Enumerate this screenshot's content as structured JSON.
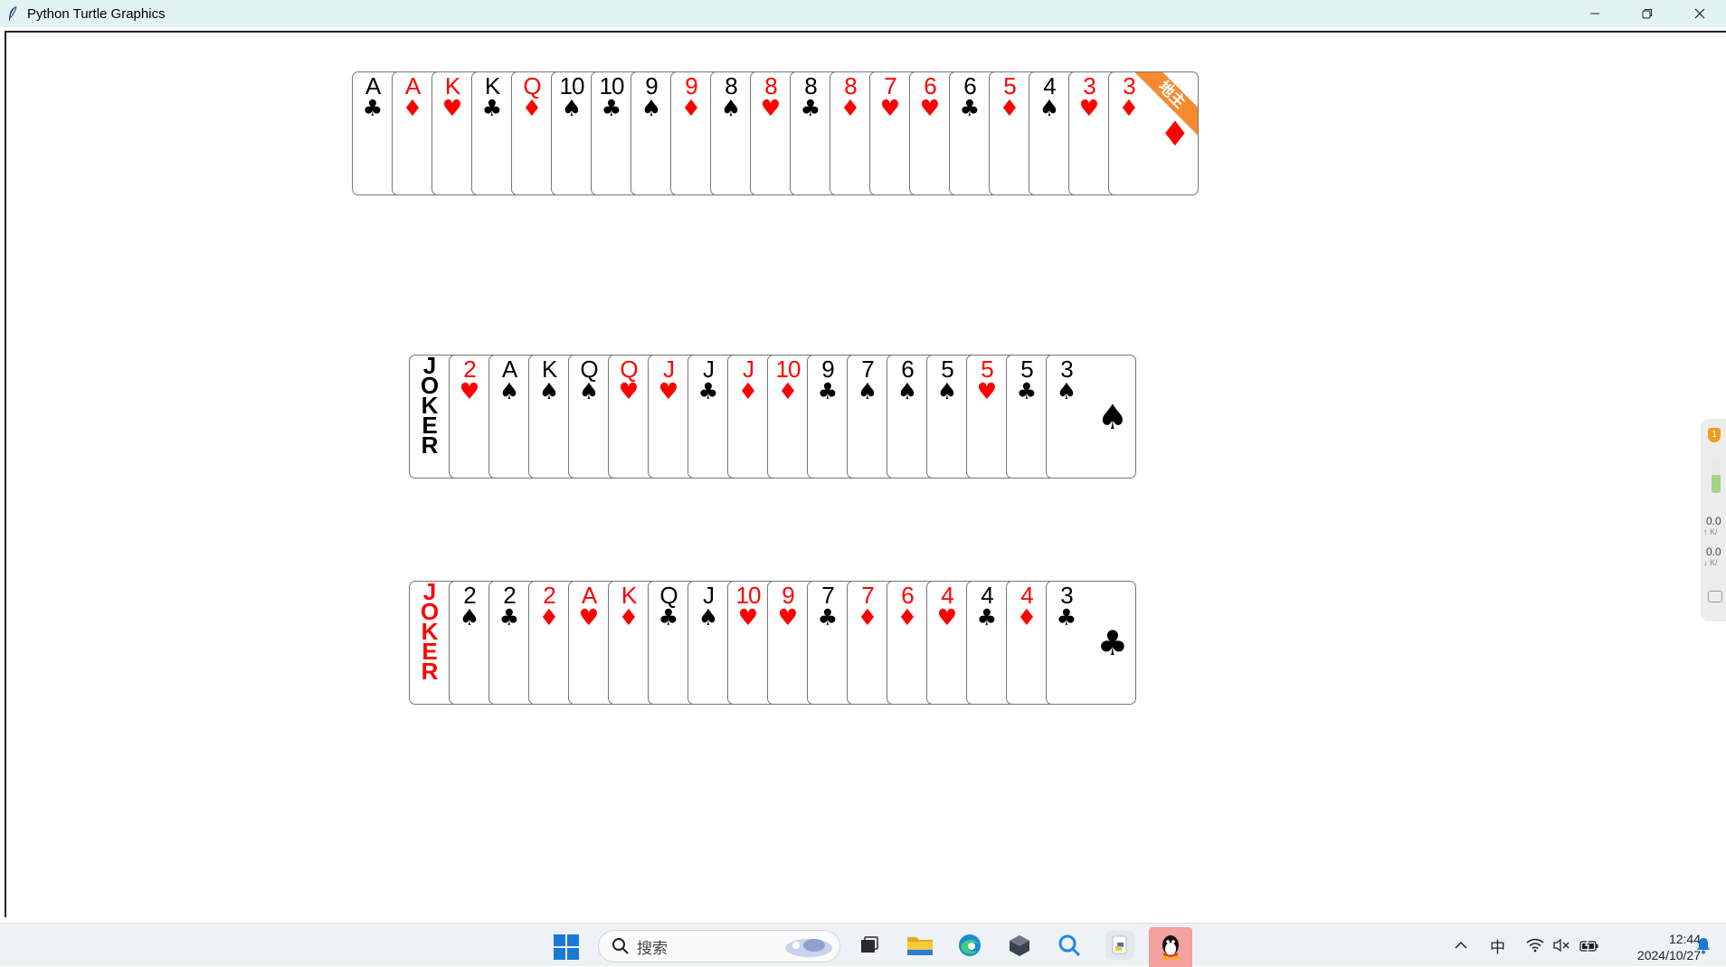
{
  "window": {
    "title": "Python Turtle Graphics"
  },
  "colors": {
    "red_suit": "#ff0000",
    "black_suit": "#000000",
    "landlord_ribbon": "#f7892e",
    "titlebar_bg": "#e2f3f3"
  },
  "hands": [
    {
      "cards": [
        {
          "rank": "A",
          "suit": "♣",
          "color": "black"
        },
        {
          "rank": "A",
          "suit": "♦",
          "color": "red"
        },
        {
          "rank": "K",
          "suit": "♥",
          "color": "red"
        },
        {
          "rank": "K",
          "suit": "♣",
          "color": "black"
        },
        {
          "rank": "Q",
          "suit": "♦",
          "color": "red"
        },
        {
          "rank": "10",
          "suit": "♠",
          "color": "black"
        },
        {
          "rank": "10",
          "suit": "♣",
          "color": "black"
        },
        {
          "rank": "9",
          "suit": "♠",
          "color": "black"
        },
        {
          "rank": "9",
          "suit": "♦",
          "color": "red"
        },
        {
          "rank": "8",
          "suit": "♠",
          "color": "black"
        },
        {
          "rank": "8",
          "suit": "♥",
          "color": "red"
        },
        {
          "rank": "8",
          "suit": "♣",
          "color": "black"
        },
        {
          "rank": "8",
          "suit": "♦",
          "color": "red"
        },
        {
          "rank": "7",
          "suit": "♥",
          "color": "red"
        },
        {
          "rank": "6",
          "suit": "♥",
          "color": "red"
        },
        {
          "rank": "6",
          "suit": "♣",
          "color": "black"
        },
        {
          "rank": "5",
          "suit": "♦",
          "color": "red"
        },
        {
          "rank": "4",
          "suit": "♠",
          "color": "black"
        },
        {
          "rank": "3",
          "suit": "♥",
          "color": "red"
        },
        {
          "rank": "3",
          "suit": "♦",
          "color": "red"
        }
      ],
      "landlord_label": "地主"
    },
    {
      "cards": [
        {
          "rank": "JOKER",
          "suit": "",
          "color": "black",
          "joker": true
        },
        {
          "rank": "2",
          "suit": "♥",
          "color": "red"
        },
        {
          "rank": "A",
          "suit": "♠",
          "color": "black"
        },
        {
          "rank": "K",
          "suit": "♠",
          "color": "black"
        },
        {
          "rank": "Q",
          "suit": "♠",
          "color": "black"
        },
        {
          "rank": "Q",
          "suit": "♥",
          "color": "red"
        },
        {
          "rank": "J",
          "suit": "♥",
          "color": "red"
        },
        {
          "rank": "J",
          "suit": "♣",
          "color": "black"
        },
        {
          "rank": "J",
          "suit": "♦",
          "color": "red"
        },
        {
          "rank": "10",
          "suit": "♦",
          "color": "red"
        },
        {
          "rank": "9",
          "suit": "♣",
          "color": "black"
        },
        {
          "rank": "7",
          "suit": "♠",
          "color": "black"
        },
        {
          "rank": "6",
          "suit": "♠",
          "color": "black"
        },
        {
          "rank": "5",
          "suit": "♠",
          "color": "black"
        },
        {
          "rank": "5",
          "suit": "♥",
          "color": "red"
        },
        {
          "rank": "5",
          "suit": "♣",
          "color": "black"
        },
        {
          "rank": "3",
          "suit": "♠",
          "color": "black"
        }
      ]
    },
    {
      "cards": [
        {
          "rank": "JOKER",
          "suit": "",
          "color": "red",
          "joker": true
        },
        {
          "rank": "2",
          "suit": "♠",
          "color": "black"
        },
        {
          "rank": "2",
          "suit": "♣",
          "color": "black"
        },
        {
          "rank": "2",
          "suit": "♦",
          "color": "red"
        },
        {
          "rank": "A",
          "suit": "♥",
          "color": "red"
        },
        {
          "rank": "K",
          "suit": "♦",
          "color": "red"
        },
        {
          "rank": "Q",
          "suit": "♣",
          "color": "black"
        },
        {
          "rank": "J",
          "suit": "♠",
          "color": "black"
        },
        {
          "rank": "10",
          "suit": "♥",
          "color": "red"
        },
        {
          "rank": "9",
          "suit": "♥",
          "color": "red"
        },
        {
          "rank": "7",
          "suit": "♣",
          "color": "black"
        },
        {
          "rank": "7",
          "suit": "♦",
          "color": "red"
        },
        {
          "rank": "6",
          "suit": "♦",
          "color": "red"
        },
        {
          "rank": "4",
          "suit": "♥",
          "color": "red"
        },
        {
          "rank": "4",
          "suit": "♣",
          "color": "black"
        },
        {
          "rank": "4",
          "suit": "♦",
          "color": "red"
        },
        {
          "rank": "3",
          "suit": "♣",
          "color": "black"
        }
      ]
    }
  ],
  "side_widget": {
    "badge": "1",
    "upload_speed": "0.0",
    "download_speed": "0.0",
    "unit": "K/"
  },
  "taskbar": {
    "search_placeholder": "搜索",
    "ime_label": "中",
    "time": "12:44",
    "date": "2024/10/27"
  }
}
